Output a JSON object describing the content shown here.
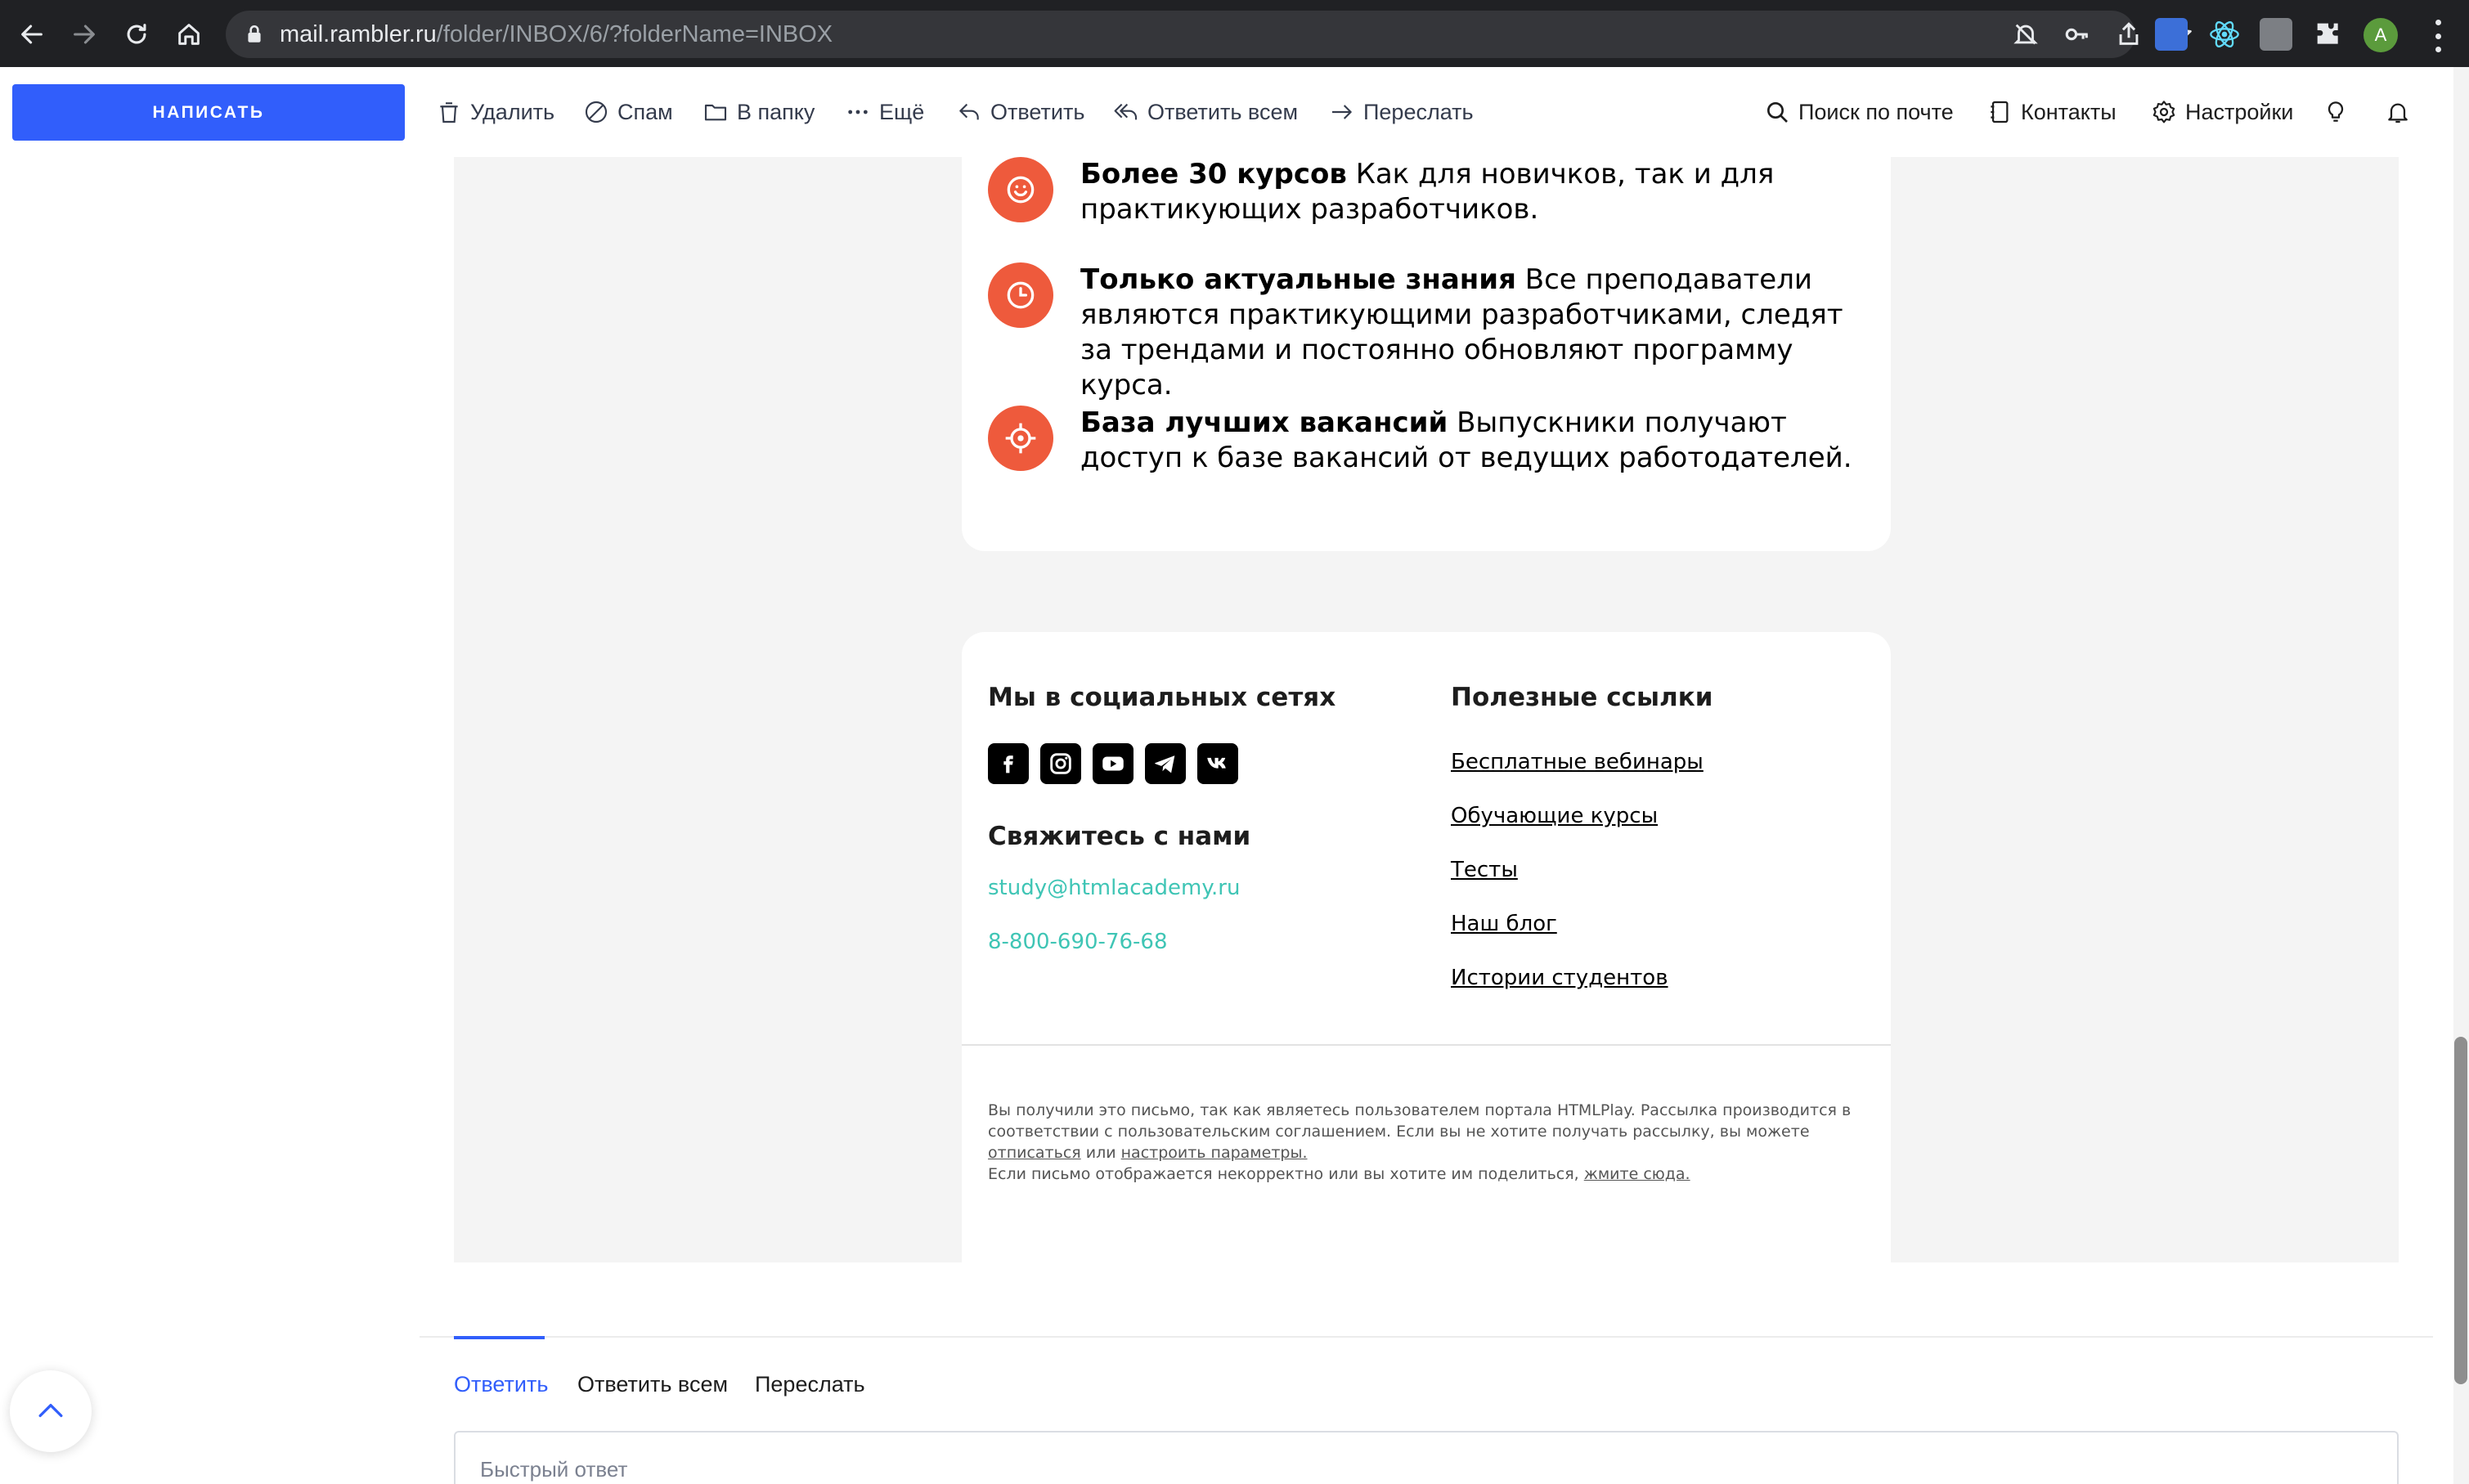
{
  "browser": {
    "url_host": "mail.rambler.ru",
    "url_path": "/folder/INBOX/6/?folderName=INBOX",
    "profile_initial": "A"
  },
  "toolbar": {
    "compose_label": "НАПИСАТЬ",
    "delete_label": "Удалить",
    "spam_label": "Спам",
    "to_folder_label": "В папку",
    "more_label": "Ещё",
    "reply_label": "Ответить",
    "reply_all_label": "Ответить всем",
    "forward_label": "Переслать",
    "search_label": "Поиск по почте",
    "contacts_label": "Контакты",
    "settings_label": "Настройки"
  },
  "email": {
    "features": [
      {
        "icon": "smile-icon",
        "title": "Более 30 курсов",
        "text": " Как для новичков, так и для практикующих разработчиков."
      },
      {
        "icon": "clock-icon",
        "title": "Только актуальные знания",
        "text": " Все преподаватели являются практикующими разработчиками, следят за трендами и постоянно обновляют программу курса."
      },
      {
        "icon": "target-icon",
        "title": "База лучших вакансий",
        "text": " Выпускники получают доступ к базе вакансий от ведущих работодателей."
      }
    ],
    "social_title": "Мы в социальных сетях",
    "social_icons": [
      "facebook-icon",
      "instagram-icon",
      "youtube-icon",
      "telegram-icon",
      "vk-icon"
    ],
    "contact_title": "Свяжитесь с нами",
    "contact_email": "study@htmlacademy.ru",
    "contact_phone": "8-800-690-76-68",
    "links_title": "Полезные ссылки",
    "links": [
      "Бесплатные вебинары",
      "Обучающие курсы",
      "Тесты",
      "Наш блог",
      "Истории студентов"
    ],
    "legal": {
      "line1": "Вы получили это письмо, так как являетесь пользователем портала HTMLPlay. Рассылка производится в соответствии с пользовательским соглашением. Если вы не хотите получать рассылку, вы можете ",
      "unsubscribe": "отписаться",
      "or": " или ",
      "configure": "настроить параметры.",
      "line2": "Если письмо отображается некорректно или вы хотите им поделиться, ",
      "click_here": "жмите сюда."
    },
    "accent_color": "#ee5a3c",
    "link_color": "#3fc5b5"
  },
  "reply": {
    "tabs": [
      "Ответить",
      "Ответить всем",
      "Переслать"
    ],
    "active_tab": "Ответить",
    "quick_placeholder": "Быстрый ответ"
  },
  "colors": {
    "primary": "#315efb",
    "chrome_bg": "#202124"
  }
}
